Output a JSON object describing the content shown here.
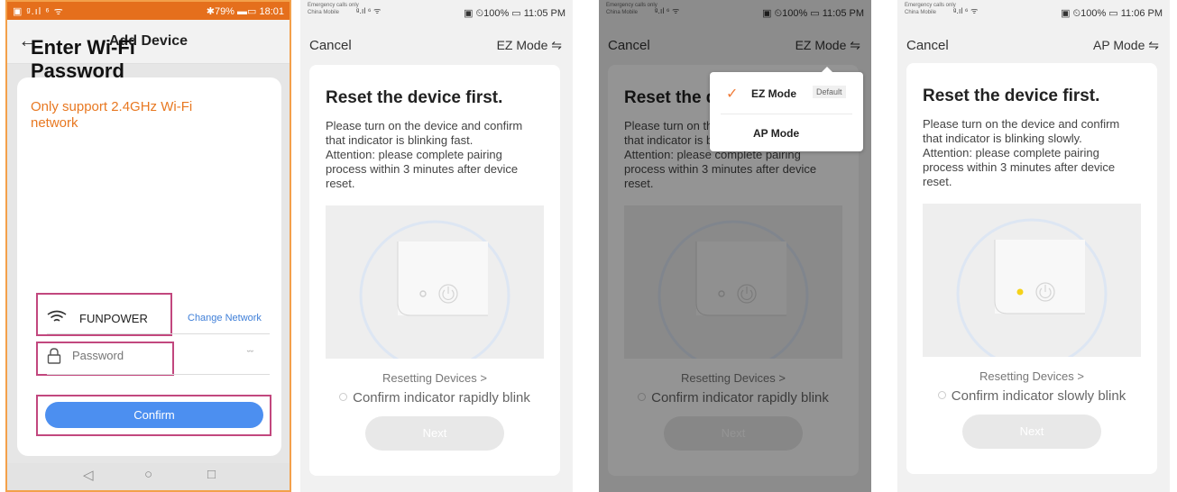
{
  "screen1": {
    "status_left": "▣ ᵍ.ıl ⁶ ᯤ",
    "status_right": "✱79% ▬▭ 18:01",
    "title": "Add Device",
    "heading": "Enter Wi-Fi\nPassword",
    "warning": "Only support 2.4GHz Wi-Fi\nnetwork",
    "wifi_name": "FUNPOWER",
    "change_network": "Change Network",
    "password_placeholder": "Password",
    "confirm_label": "Confirm",
    "highlight_color": "#c2477e",
    "accent": "#4c8ff0",
    "warning_color": "#e87821"
  },
  "screen2": {
    "status_line1": "Emergency calls only",
    "status_line2": "China Mobile",
    "status_signal": "ᵍ.ıl ⁶ ᯤ",
    "status_right": "▣ ⏲100% ▭ 11:05 PM",
    "cancel": "Cancel",
    "mode": "EZ Mode ⇋",
    "title": "Reset the device first.",
    "desc": "Please turn on the device and confirm\nthat indicator is blinking fast.\nAttention: please complete pairing\nprocess within 3 minutes after device\nreset.",
    "resetting": "Resetting Devices >",
    "confirm": "Confirm indicator rapidly blink",
    "next": "Next",
    "indicator_color": "#cfcfcf"
  },
  "screen3": {
    "status_line1": "Emergency calls only",
    "status_line2": "China Mobile",
    "status_signal": "ᵍ.ıl ⁶ ᯤ",
    "status_right": "▣ ⏲100% ▭ 11:05 PM",
    "cancel": "Cancel",
    "mode": "EZ Mode ⇋",
    "title": "Reset the device first.",
    "desc": "Please turn on the device and confirm\nthat indicator is blinking fast.\nAttention: please complete pairing\nprocess within 3 minutes after device\nreset.",
    "resetting": "Resetting Devices >",
    "confirm": "Confirm indicator rapidly blink",
    "next": "Next",
    "indicator_color": "#cfcfcf",
    "dropdown": {
      "options": [
        {
          "label": "EZ Mode",
          "badge": "Default",
          "selected": true
        },
        {
          "label": "AP Mode",
          "badge": "",
          "selected": false
        }
      ],
      "check_color": "#f07c3a"
    }
  },
  "screen4": {
    "status_line1": "Emergency calls only",
    "status_line2": "China Mobile",
    "status_signal": "ᵍ.ıl ⁶ ᯤ",
    "status_right": "▣ ⏲100% ▭ 11:06 PM",
    "cancel": "Cancel",
    "mode": "AP Mode ⇋",
    "title": "Reset the device first.",
    "desc": "Please turn on the device and confirm\nthat indicator is blinking slowly.\nAttention: please complete pairing\nprocess within 3 minutes after device\nreset.",
    "resetting": "Resetting Devices >",
    "confirm": "Confirm indicator slowly blink",
    "next": "Next",
    "indicator_color": "#f5d21a"
  },
  "nav_icons": [
    "back-triangle",
    "home-circle",
    "recents-square"
  ]
}
